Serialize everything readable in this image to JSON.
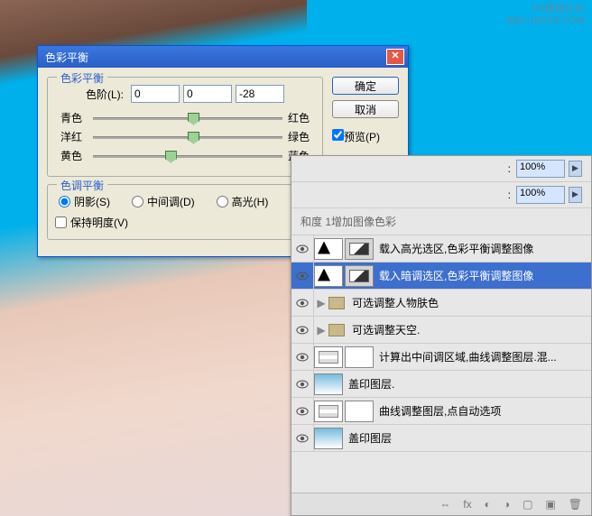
{
  "watermark": {
    "l1": "PS教程论坛",
    "l2": "BBS.16XX8.COM"
  },
  "dialog": {
    "title": "色彩平衡",
    "group_color": "色彩平衡",
    "level_label": "色阶(L):",
    "v0": "0",
    "v1": "0",
    "v2": "-28",
    "s_cyan": "青色",
    "s_red": "红色",
    "s_magenta": "洋红",
    "s_green": "绿色",
    "s_yellow": "黄色",
    "s_blue": "蓝色",
    "group_tone": "色调平衡",
    "r_shadow": "阴影(S)",
    "r_mid": "中间调(D)",
    "r_high": "高光(H)",
    "preserve": "保持明度(V)",
    "ok": "确定",
    "cancel": "取消",
    "preview": "预览(P)"
  },
  "panel": {
    "pct": "100%",
    "toptext": "和度 1增加图像色彩",
    "layers": [
      {
        "name": "载入高光选区,色彩平衡调整图像",
        "sel": false,
        "type": "adj"
      },
      {
        "name": "载入暗调选区,色彩平衡调整图像",
        "sel": true,
        "type": "adj"
      },
      {
        "name": "可选调整人物肤色",
        "sel": false,
        "type": "folder"
      },
      {
        "name": "可选调整天空.",
        "sel": false,
        "type": "folder"
      },
      {
        "name": "计算出中间调区域,曲线调整图层.混...",
        "sel": false,
        "type": "curve"
      },
      {
        "name": "盖印图层.",
        "sel": false,
        "type": "img"
      },
      {
        "name": "曲线调整图层,点自动选项",
        "sel": false,
        "type": "curve"
      },
      {
        "name": "盖印图层",
        "sel": false,
        "type": "img"
      }
    ],
    "icons": {
      "link": "⇔",
      "fx": "fx",
      "mask": "◐",
      "adj": "◑",
      "folder": "▢",
      "new": "▣",
      "trash": "🗑"
    }
  }
}
